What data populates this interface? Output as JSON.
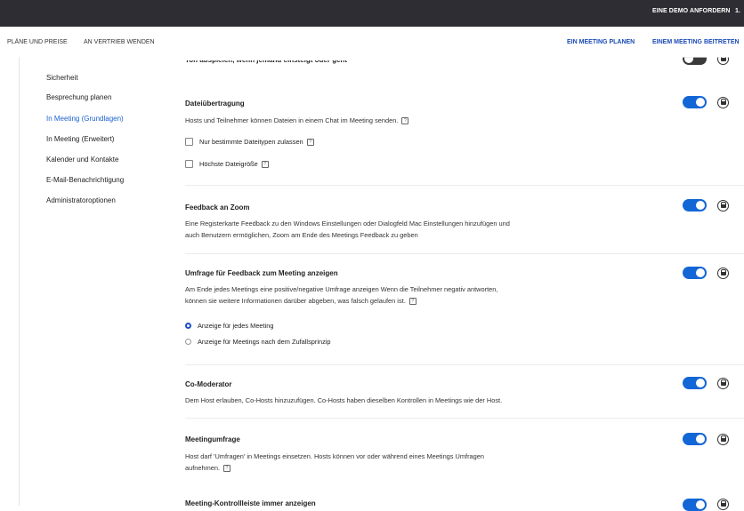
{
  "topbar": {
    "demo_label": "EINE DEMO ANFORDERN",
    "phone_fragment": "1."
  },
  "nav": {
    "plans": "PLÄNE UND PREISE",
    "sales": "AN VERTRIEB WENDEN",
    "schedule": "EIN MEETING PLANEN",
    "join": "EINEM MEETING BEITRETEN"
  },
  "sidebar": {
    "items": [
      {
        "label": "Sicherheit"
      },
      {
        "label": "Besprechung planen"
      },
      {
        "label": "In Meeting (Grundlagen)"
      },
      {
        "label": "In Meeting (Erweitert)"
      },
      {
        "label": "Kalender und Kontakte"
      },
      {
        "label": "E-Mail-Benachrichtigung"
      },
      {
        "label": "Administratoroptionen"
      }
    ]
  },
  "settings": {
    "prev_fragment": "Ton abspielen, wenn jemand einsteigt oder geht",
    "file_transfer": {
      "title": "Dateiübertragung",
      "desc": "Hosts und Teilnehmer können Dateien in einem Chat im Meeting senden.",
      "opt1": "Nur bestimmte Dateitypen zulassen",
      "opt2": "Höchste Dateigröße"
    },
    "feedback": {
      "title": "Feedback an Zoom",
      "desc1": "Eine Registerkarte Feedback zu den Windows Einstellungen oder Dialogfeld Mac Einstellungen hinzufügen und",
      "desc2": "auch Benutzern ermöglichen, Zoom am Ende des Meetings Feedback zu geben"
    },
    "survey": {
      "title": "Umfrage für Feedback zum Meeting anzeigen",
      "desc1": "Am Ende jedes Meetings eine positive/negative Umfrage anzeigen Wenn die Teilnehmer negativ antworten,",
      "desc2": "können sie weitere Informationen darüber abgeben, was falsch gelaufen ist.",
      "radio1": "Anzeige für jedes Meeting",
      "radio2": "Anzeige für Meetings nach dem Zufallsprinzip"
    },
    "comod": {
      "title": "Co-Moderator",
      "desc": "Dem Host erlauben, Co-Hosts hinzuzufügen. Co-Hosts haben dieselben Kontrollen in Meetings wie der Host."
    },
    "poll": {
      "title": "Meetingumfrage",
      "desc1": "Host darf 'Umfragen' in Meetings einsetzen. Hosts können vor oder während eines Meetings Umfragen",
      "desc2": "aufnehmen."
    },
    "next_fragment": "Meeting-Kontrollleiste immer anzeigen"
  },
  "colors": {
    "toggle_on": "#1366d6",
    "link": "#1a4ab5",
    "topbar": "#2d2d33"
  }
}
